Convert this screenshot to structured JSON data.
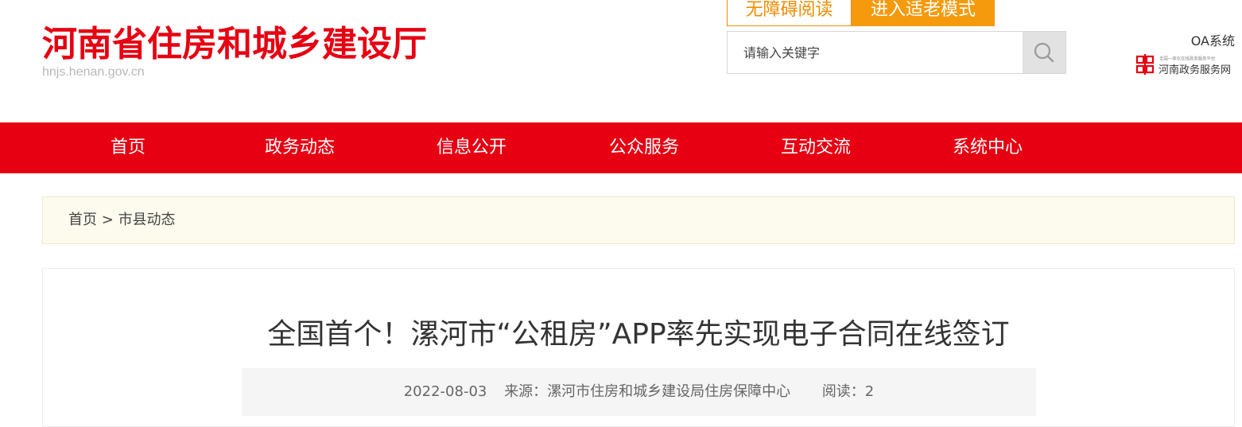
{
  "header": {
    "site_title": "河南省住房和城乡建设厅",
    "site_domain": "hnjs.henan.gov.cn",
    "accessibility_label": "无障碍阅读",
    "elder_mode_label": "进入适老模式",
    "search": {
      "placeholder": "请输入关键字"
    },
    "oa_label": "OA系统",
    "gov_service": {
      "small_text": "全国一体化在线政务服务平台",
      "label": "河南政务服务网"
    }
  },
  "colors": {
    "brand_red": "#e60012",
    "accent_orange": "#f59a0c"
  },
  "nav": {
    "items": [
      {
        "label": "首页"
      },
      {
        "label": "政务动态"
      },
      {
        "label": "信息公开"
      },
      {
        "label": "公众服务"
      },
      {
        "label": "互动交流"
      },
      {
        "label": "系统中心"
      }
    ]
  },
  "breadcrumb": {
    "home": "首页",
    "separator": ">",
    "current": "市县动态"
  },
  "article": {
    "title": "全国首个！漯河市“公租房”APP率先实现电子合同在线签订",
    "date": "2022-08-03",
    "source": "来源：漯河市住房和城乡建设局住房保障中心",
    "reads": "阅读：2"
  }
}
